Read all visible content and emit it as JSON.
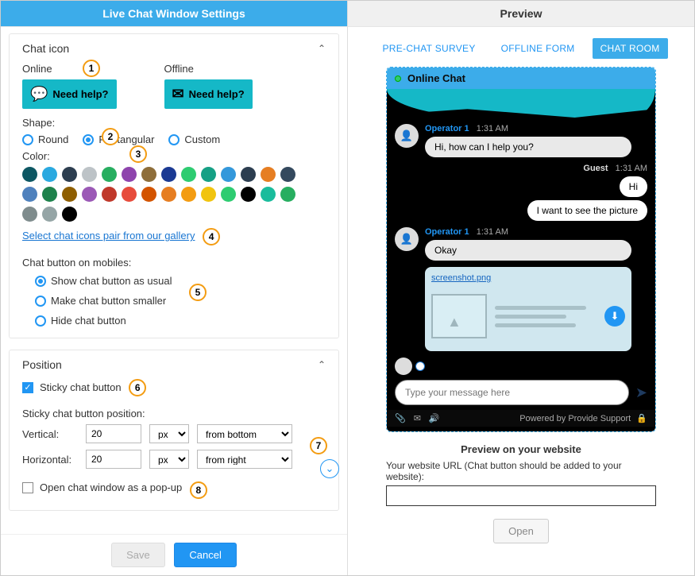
{
  "left": {
    "header": "Live Chat Window Settings",
    "sections": {
      "chatIcon": {
        "title": "Chat icon",
        "onlineLabel": "Online",
        "offlineLabel": "Offline",
        "needHelp": "Need help?",
        "shapeLabel": "Shape:",
        "shapes": [
          "Round",
          "Rectangular",
          "Custom"
        ],
        "selectedShape": "Rectangular",
        "colorLabel": "Color:",
        "colors": [
          "#0d5763",
          "#2aa9e0",
          "#2d3e50",
          "#bdc3c7",
          "#27ae60",
          "#8e44ad",
          "#8e6e3a",
          "#1b3a93",
          "#2ecc71",
          "#16a085",
          "#3498db",
          "#2c3e50",
          "#e67e22",
          "#34495e",
          "#4f81bd",
          "#1e824c",
          "#8e5e00",
          "#9b59b6",
          "#c0392b",
          "#e74c3c",
          "#d35400",
          "#e67e22",
          "#f39c12",
          "#f1c40f",
          "#2ecc71",
          "#000000",
          "#1abc9c",
          "#27ae60",
          "#7f8c8d",
          "#95a5a6",
          "#000000"
        ],
        "galleryLink": "Select chat icons pair from our gallery",
        "mobileLabel": "Chat button on mobiles:",
        "mobileOptions": [
          "Show chat button as usual",
          "Make chat button smaller",
          "Hide chat button"
        ],
        "mobileSelected": "Show chat button as usual"
      },
      "position": {
        "title": "Position",
        "stickyLabel": "Sticky chat button",
        "stickyChecked": true,
        "posLabel": "Sticky chat button position:",
        "verticalLabel": "Vertical:",
        "horizontalLabel": "Horizontal:",
        "vVal": "20",
        "hVal": "20",
        "unit": "px",
        "vFrom": "from bottom",
        "hFrom": "from right",
        "popupLabel": "Open chat window as a pop-up",
        "popupChecked": false
      }
    },
    "footer": {
      "save": "Save",
      "cancel": "Cancel"
    },
    "markers": {
      "m1": "1",
      "m2": "2",
      "m3": "3",
      "m4": "4",
      "m5": "5",
      "m6": "6",
      "m7": "7",
      "m8": "8"
    }
  },
  "right": {
    "header": "Preview",
    "tabs": [
      "PRE-CHAT SURVEY",
      "OFFLINE FORM",
      "CHAT ROOM"
    ],
    "activeTab": "CHAT ROOM",
    "chat": {
      "title": "Online Chat",
      "operatorName": "Operator 1",
      "guestName": "Guest",
      "time": "1:31 AM",
      "msgs": {
        "op1": "Hi, how can I help you?",
        "g1": "Hi",
        "g2": "I want to see the picture",
        "op2": "Okay",
        "attachment": "screenshot.png"
      },
      "placeholder": "Type your message here",
      "powered": "Powered by Provide Support"
    },
    "previewLabel": "Preview on your website",
    "urlLabel": "Your website URL (Chat button should be added to your website):",
    "openBtn": "Open"
  }
}
